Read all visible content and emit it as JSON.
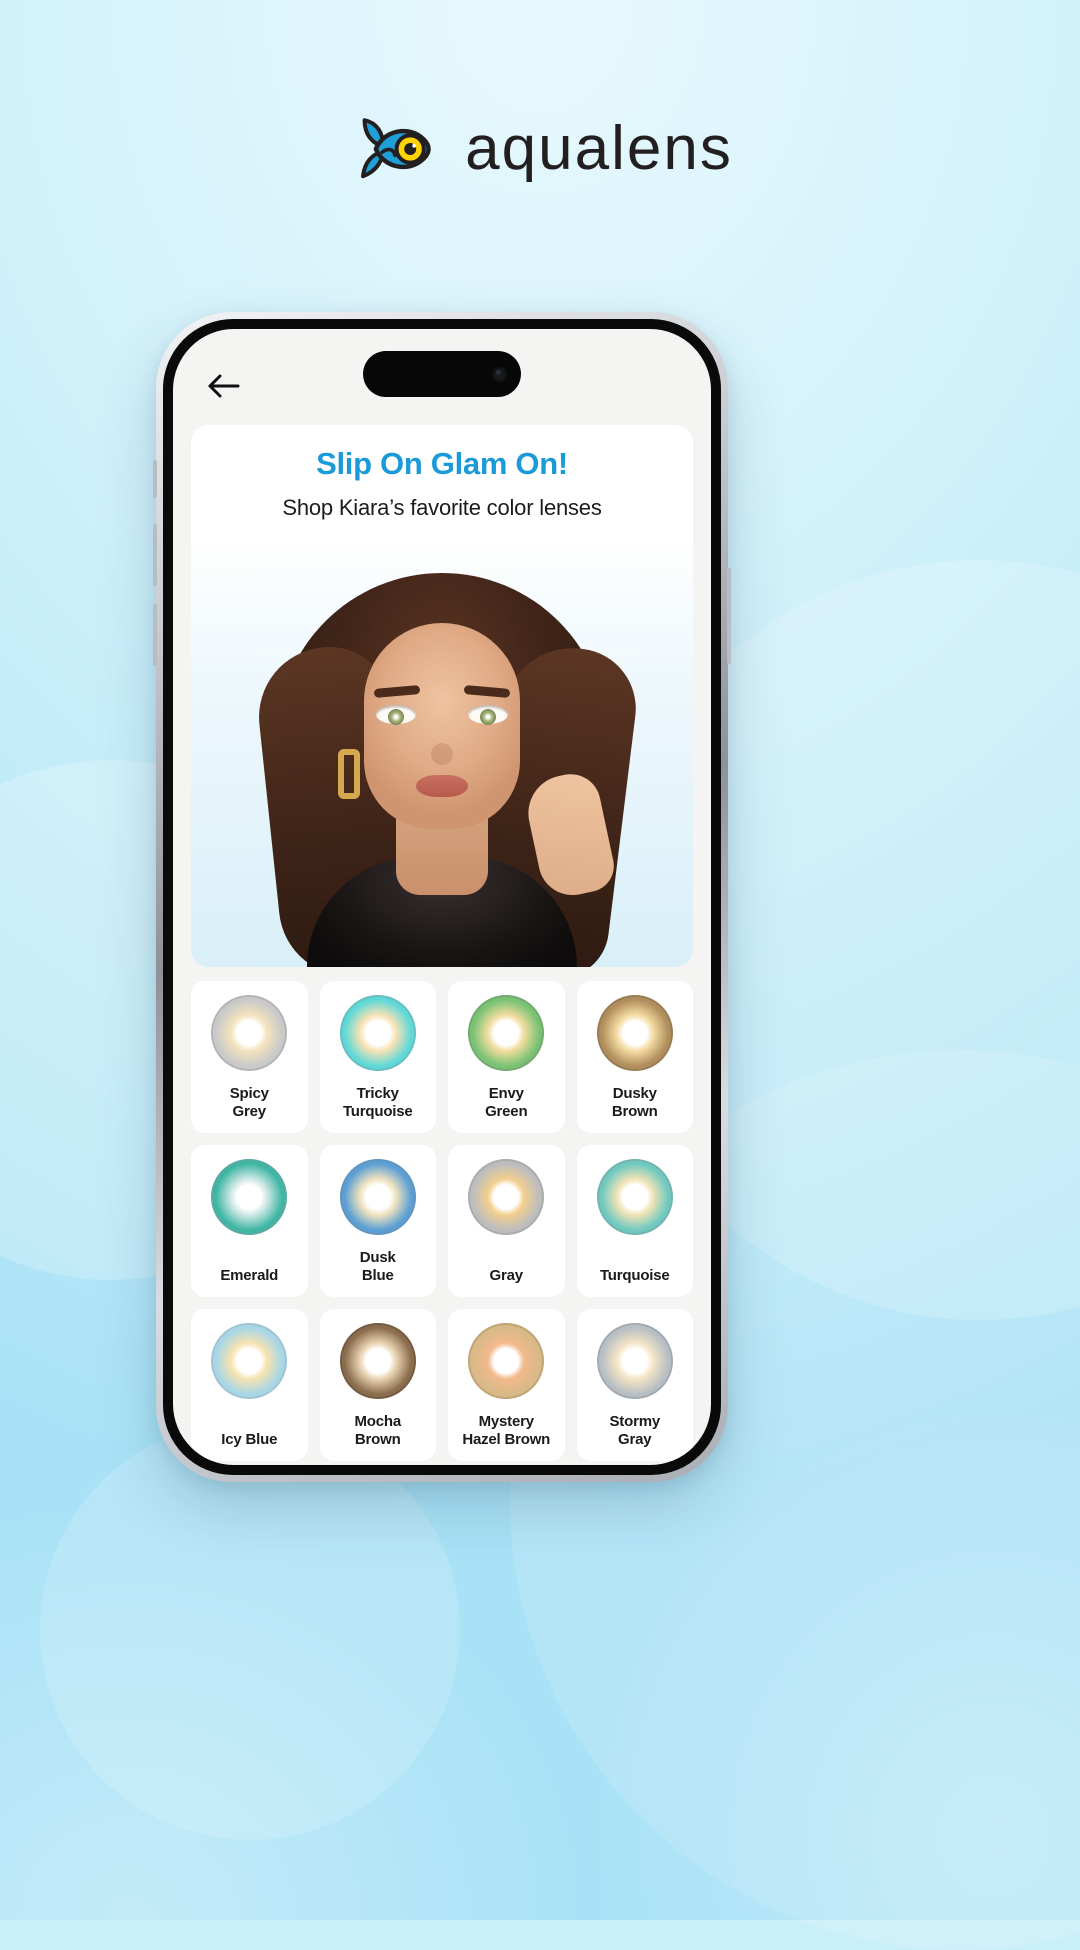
{
  "brand": {
    "logo_icon": "fish-eye-logo-icon",
    "name_part1": "aqua",
    "name_part2": "lens",
    "accent_color": "#1b9ad8",
    "logo_fish_color": "#1f9fd8",
    "logo_eye_color": "#ffd400"
  },
  "phone": {
    "status_island": "dynamic-island",
    "back_icon": "arrow-left-icon"
  },
  "hero": {
    "title": "Slip On Glam On!",
    "subtitle": "Shop Kiara’s favorite color lenses",
    "photo_alt": "model-wearing-color-lenses"
  },
  "products": [
    {
      "name": "Spicy\nGrey",
      "label_line1": "Spicy",
      "label_line2": "Grey",
      "ring_outer": "#8d8d8d",
      "ring_mid": "#c9c9c9",
      "ring_inner": "#f3e3bd"
    },
    {
      "name": "Tricky\nTurquoise",
      "label_line1": "Tricky",
      "label_line2": "Turquoise",
      "ring_outer": "#7e8a8c",
      "ring_mid": "#5fd8d8",
      "ring_inner": "#f6e2b4"
    },
    {
      "name": "Envy\nGreen",
      "label_line1": "Envy",
      "label_line2": "Green",
      "ring_outer": "#6d7a6a",
      "ring_mid": "#79c274",
      "ring_inner": "#f1dc9e"
    },
    {
      "name": "Dusky\nBrown",
      "label_line1": "Dusky",
      "label_line2": "Brown",
      "ring_outer": "#6f5c42",
      "ring_mid": "#b08e5d",
      "ring_inner": "#f4dca2"
    },
    {
      "name": "Emerald",
      "label_line1": "Emerald",
      "label_line2": "",
      "ring_outer": "#8d949b",
      "ring_mid": "#3fb6a4",
      "ring_inner": "#cfe8e6"
    },
    {
      "name": "Dusk\nBlue",
      "label_line1": "Dusk",
      "label_line2": "Blue",
      "ring_outer": "#6f8296",
      "ring_mid": "#5b9fd4",
      "ring_inner": "#efe2bd"
    },
    {
      "name": "Gray",
      "label_line1": "Gray",
      "label_line2": "",
      "ring_outer": "#8b8b8b",
      "ring_mid": "#bdbdbd",
      "ring_inner": "#f2cf8e"
    },
    {
      "name": "Turquoise",
      "label_line1": "Turquoise",
      "label_line2": "",
      "ring_outer": "#7f8a8b",
      "ring_mid": "#6fc9c0",
      "ring_inner": "#f0e3b6"
    },
    {
      "name": "Icy Blue",
      "label_line1": "Icy Blue",
      "label_line2": "",
      "ring_outer": "#94a3ad",
      "ring_mid": "#a8d6e6",
      "ring_inner": "#f6e3b0"
    },
    {
      "name": "Mocha\nBrown",
      "label_line1": "Mocha",
      "label_line2": "Brown",
      "ring_outer": "#4a382a",
      "ring_mid": "#8b6d4e",
      "ring_inner": "#e8d3b2"
    },
    {
      "name": "Mystery\nHazel Brown",
      "label_line1": "Mystery",
      "label_line2": "Hazel Brown",
      "ring_outer": "#9a7b4e",
      "ring_mid": "#d8b987",
      "ring_inner": "#f3b98d"
    },
    {
      "name": "Stormy\nGray",
      "label_line1": "Stormy",
      "label_line2": "Gray",
      "ring_outer": "#7e8389",
      "ring_mid": "#b8bfc4",
      "ring_inner": "#f4e5c6"
    }
  ]
}
